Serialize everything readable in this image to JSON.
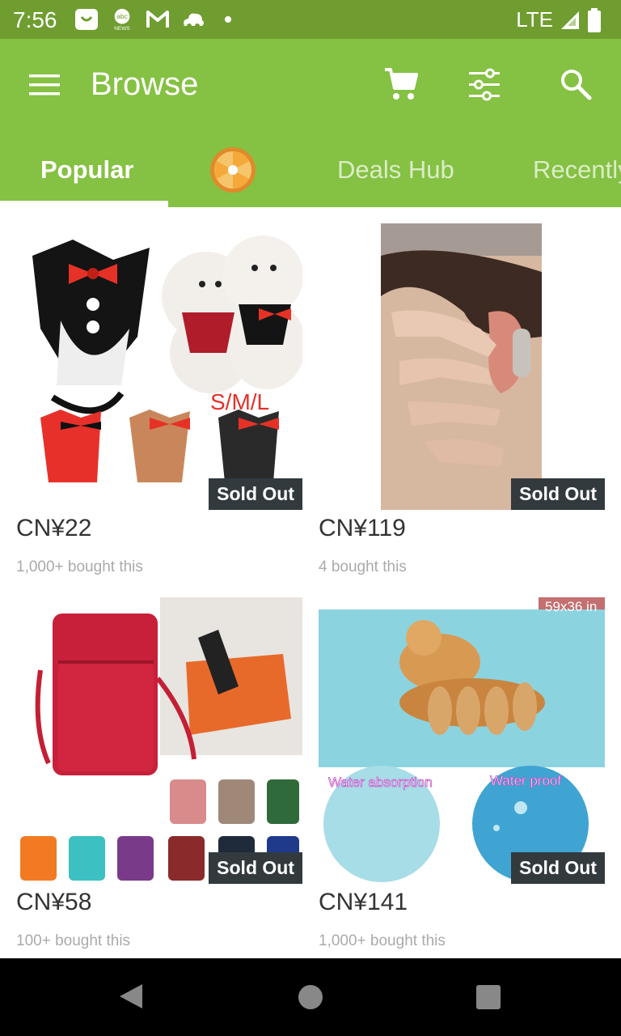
{
  "status_bar": {
    "time": "7:56",
    "network": "LTE",
    "notification_icons": [
      "messenger-icon",
      "abc-news-icon",
      "gmail-icon",
      "cloud-app-icon",
      "dot-icon"
    ]
  },
  "app_bar": {
    "title": "Browse",
    "actions": [
      "cart-icon",
      "filter-icon",
      "search-icon"
    ]
  },
  "tabs": [
    {
      "label": "Popular",
      "active": true
    },
    {
      "label": "",
      "icon": "spin-wheel-icon"
    },
    {
      "label": "Deals Hub",
      "active": false
    },
    {
      "label": "Recently",
      "active": false
    }
  ],
  "products": [
    {
      "price": "CN¥22",
      "bought": "1,000+ bought this",
      "badge": "Sold Out",
      "image_text": "S/M/L"
    },
    {
      "price": "CN¥119",
      "bought": "4 bought this",
      "badge": "Sold Out"
    },
    {
      "price": "CN¥58",
      "bought": "100+ bought this",
      "badge": "Sold Out"
    },
    {
      "price": "CN¥141",
      "bought": "1,000+ bought this",
      "badge": "Sold Out",
      "image_text": {
        "size": "59x36 in",
        "left_label": "Water absorption",
        "right_label": "Water proof"
      }
    }
  ],
  "colors": {
    "appbar": "#85c143",
    "statusbar": "#6f9d2f",
    "badge": "#323a3e"
  }
}
